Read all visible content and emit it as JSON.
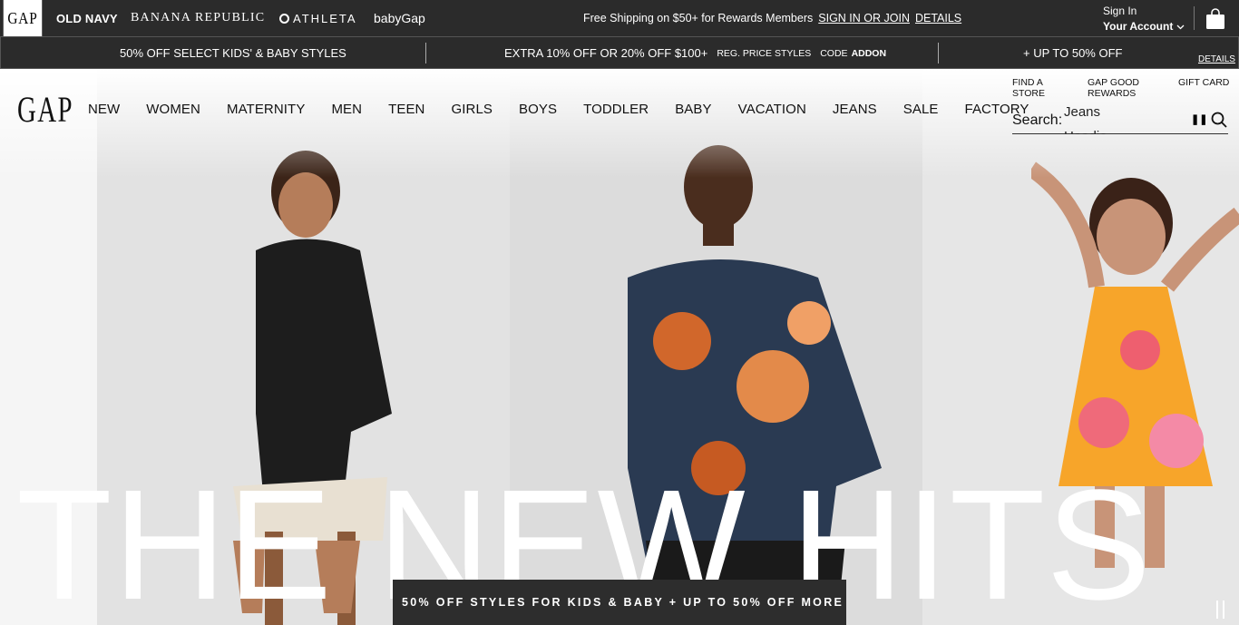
{
  "brand_bar": {
    "gap": "GAP",
    "old_navy": "OLD NAVY",
    "banana_republic": "BANANA REPUBLIC",
    "athleta": "ATHLETA",
    "babygap": "babyGap",
    "shipping_text": "Free Shipping on $50+ for Rewards Members",
    "sign_in_join": "SIGN IN OR JOIN",
    "details": "DETAILS",
    "sign_in": "Sign In",
    "your_account": "Your Account"
  },
  "promo_bar": {
    "promo1": "50% OFF SELECT KIDS' & BABY STYLES",
    "promo2_main": "EXTRA 10% OFF OR 20% OFF $100+",
    "promo2_reg": "REG. PRICE STYLES",
    "promo2_code_label": "CODE",
    "promo2_code": "ADDON",
    "promo3": "+ UP TO 50% OFF",
    "details": "DETAILS"
  },
  "header": {
    "logo": "GAP",
    "nav": [
      "NEW",
      "WOMEN",
      "MATERNITY",
      "MEN",
      "TEEN",
      "GIRLS",
      "BOYS",
      "TODDLER",
      "BABY",
      "VACATION",
      "JEANS",
      "SALE",
      "FACTORY"
    ],
    "utility": {
      "find_store": "FIND A STORE",
      "rewards": "GAP GOOD REWARDS",
      "gift_card": "GIFT CARD"
    },
    "search": {
      "label": "Search:",
      "suggestions": [
        "Jeans",
        "Hoodie"
      ]
    }
  },
  "hero": {
    "headline": "THE NEW HITS",
    "bottom_promo": "50% OFF STYLES FOR KIDS & BABY + UP TO 50% OFF MORE"
  },
  "colors": {
    "bar_bg": "#2b2b2b",
    "promo_bg": "#2d2d2d",
    "text_light": "#ffffff"
  }
}
